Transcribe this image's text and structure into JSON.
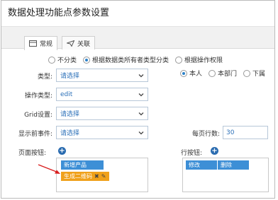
{
  "window": {
    "title": "数据处理功能点参数设置"
  },
  "tabs": [
    {
      "label": "常规",
      "icon": "table-icon"
    },
    {
      "label": "关联",
      "icon": "send-icon"
    }
  ],
  "classify": {
    "options": [
      "不分类",
      "根据数据类所有者类型分类",
      "根据操作权限"
    ],
    "selected": 1
  },
  "fields": {
    "type": {
      "label": "类型:",
      "value": "请选择"
    },
    "op_type": {
      "label": "操作类型:",
      "value": "edit"
    },
    "grid": {
      "label": "Grid设置:",
      "value": "请选择"
    },
    "pre_event": {
      "label": "显示前事件:",
      "value": "请选择"
    },
    "page_size": {
      "label": "每页行数:",
      "value": "30"
    }
  },
  "scope": {
    "options": [
      "本人",
      "本部门",
      "下属"
    ],
    "selected": 0
  },
  "page_buttons": {
    "label": "页面按钮:",
    "items": [
      "新增产品",
      "生成二维码"
    ]
  },
  "row_buttons": {
    "label": "行按钮:",
    "items": [
      "修改",
      "删除"
    ]
  },
  "colors": {
    "accent": "#2b6cb0",
    "chip_blue": "#3d8fd6",
    "chip_orange": "#f0a11b",
    "arrow": "#d81e1e"
  }
}
